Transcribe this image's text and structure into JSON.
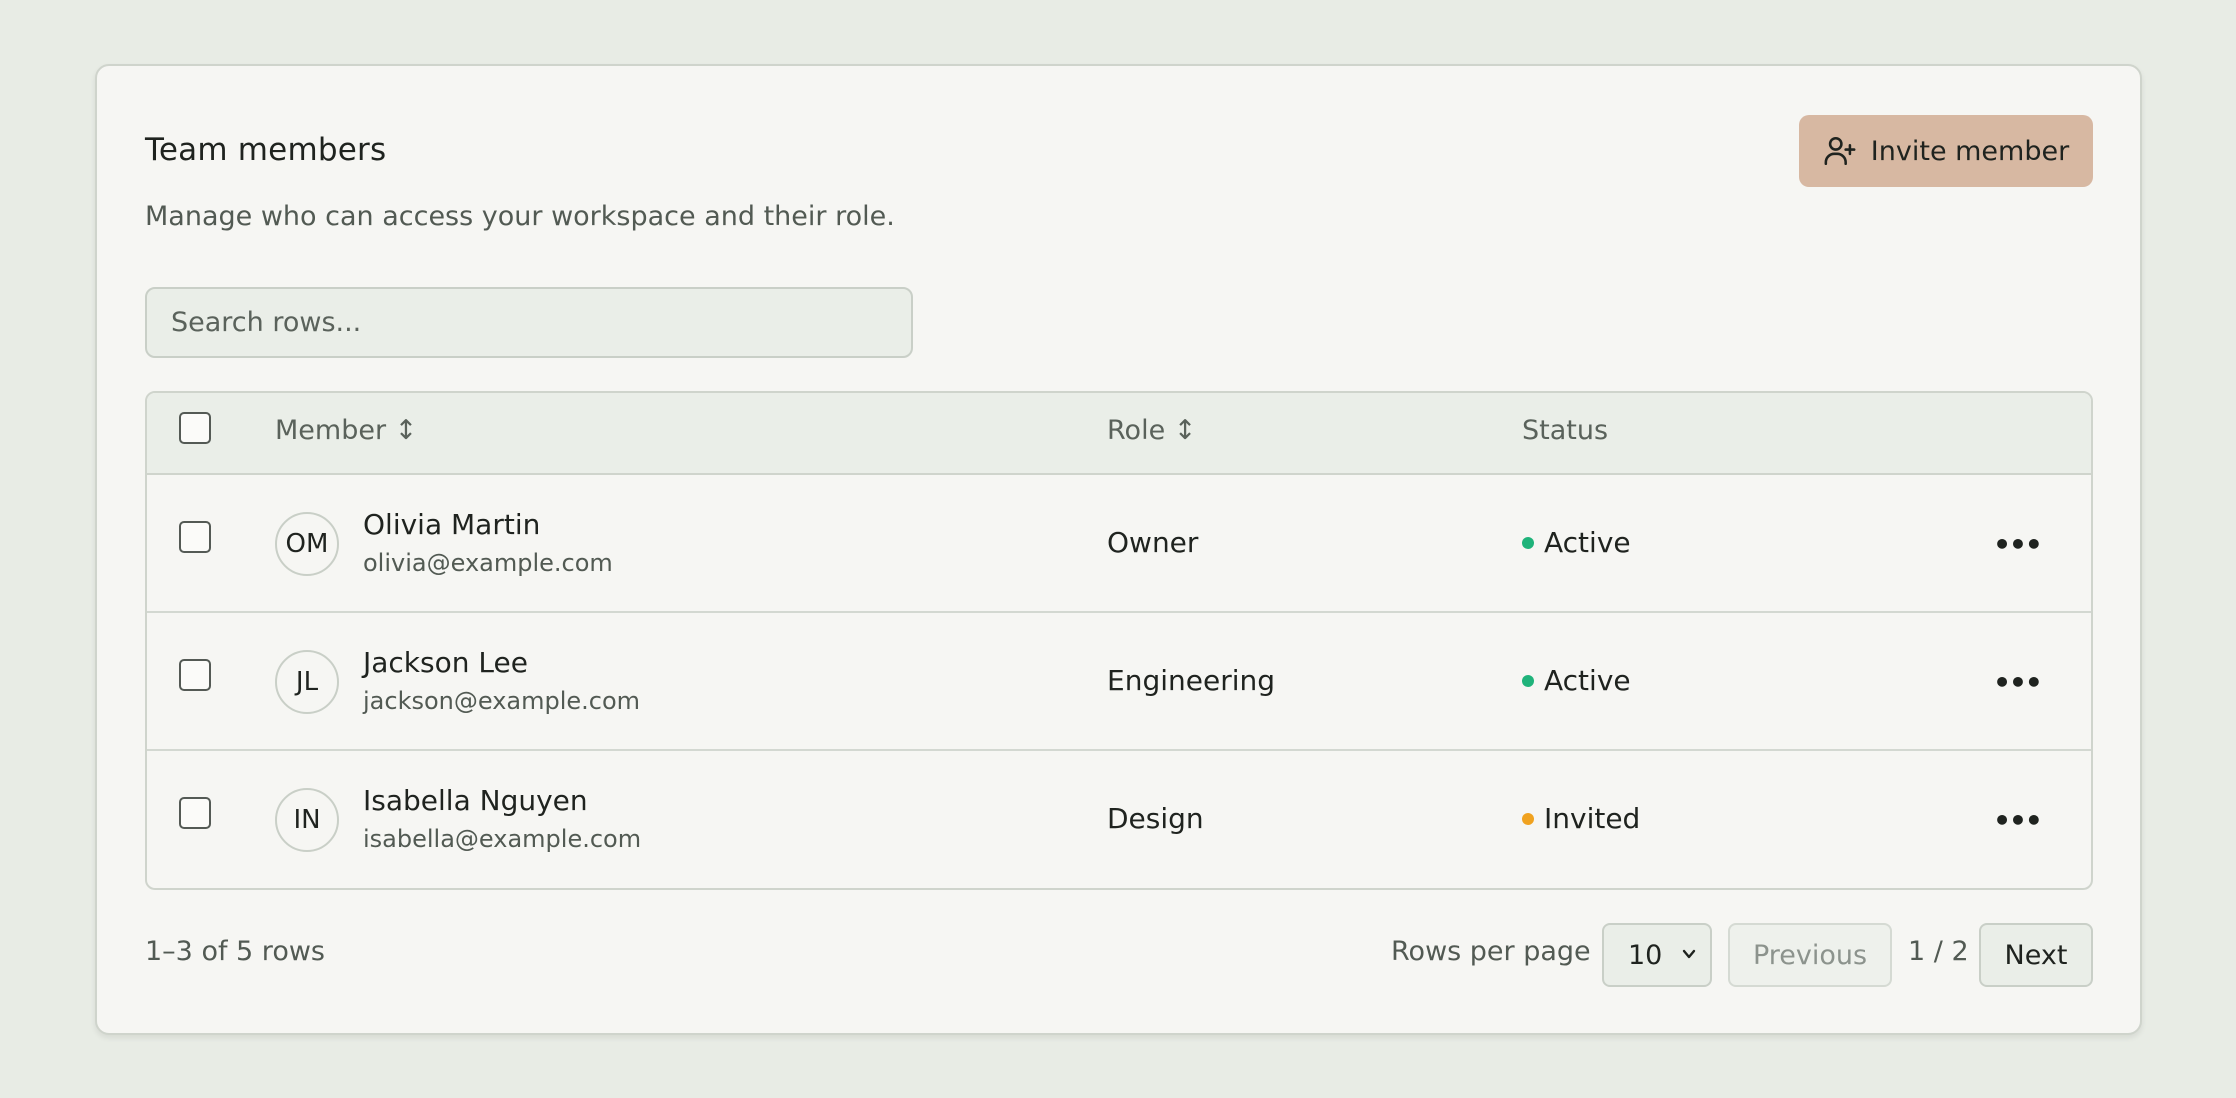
{
  "header": {
    "title": "Team members",
    "subtitle": "Manage who can access your workspace and their role.",
    "invite_label": "Invite member",
    "invite_icon": "user-plus-icon"
  },
  "search": {
    "placeholder": "Search rows..."
  },
  "table": {
    "columns": {
      "member": "Member ↕",
      "role": "Role ↕",
      "status": "Status"
    },
    "rows": [
      {
        "initials": "OM",
        "name": "Olivia Martin",
        "email": "olivia@example.com",
        "role": "Owner",
        "status": "Active",
        "status_color": "#1fb37a"
      },
      {
        "initials": "JL",
        "name": "Jackson Lee",
        "email": "jackson@example.com",
        "role": "Engineering",
        "status": "Active",
        "status_color": "#1fb37a"
      },
      {
        "initials": "IN",
        "name": "Isabella Nguyen",
        "email": "isabella@example.com",
        "role": "Design",
        "status": "Invited",
        "status_color": "#f0a21f"
      }
    ],
    "row_menu_icon": "more-horizontal-icon"
  },
  "footer": {
    "summary": "1–3 of 5 rows",
    "rows_per_page_label": "Rows per page",
    "rows_per_page_value": "10",
    "previous_label": "Previous",
    "page_indicator": "1 / 2",
    "next_label": "Next"
  },
  "colors": {
    "accent_button": "#d7b8a2",
    "background": "#e8ece5",
    "card": "#f6f6f3",
    "active": "#1fb37a",
    "invited": "#f0a21f"
  }
}
